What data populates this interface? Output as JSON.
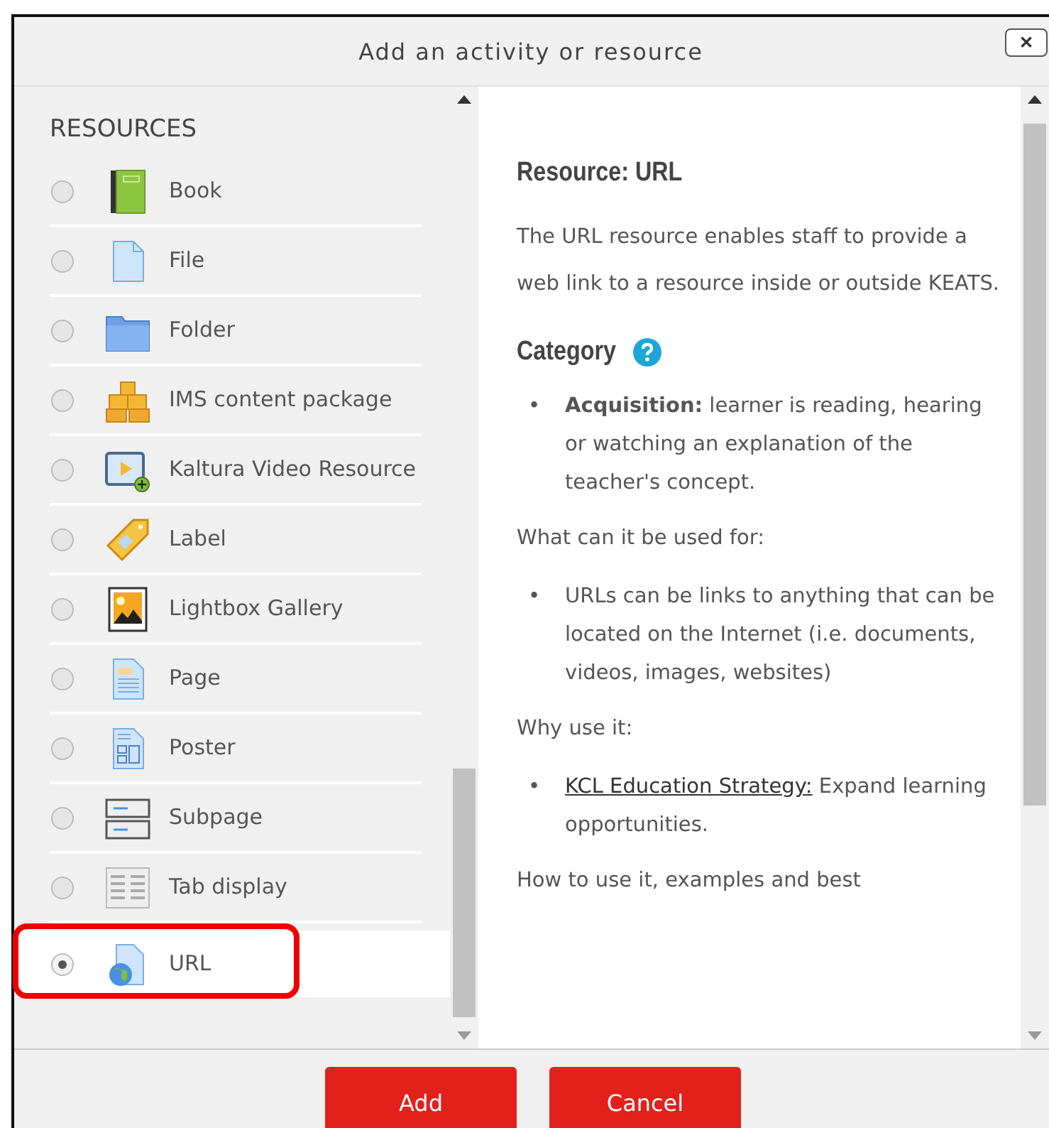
{
  "dialog": {
    "title": "Add an activity or resource",
    "close": "✕"
  },
  "section_title": "RESOURCES",
  "items": [
    {
      "label": "Book",
      "kind": "book",
      "selected": false
    },
    {
      "label": "File",
      "kind": "file",
      "selected": false
    },
    {
      "label": "Folder",
      "kind": "folder",
      "selected": false
    },
    {
      "label": "IMS content package",
      "kind": "package",
      "selected": false
    },
    {
      "label": "Kaltura Video Resource",
      "kind": "video",
      "selected": false
    },
    {
      "label": "Label",
      "kind": "label",
      "selected": false
    },
    {
      "label": "Lightbox Gallery",
      "kind": "gallery",
      "selected": false
    },
    {
      "label": "Page",
      "kind": "page",
      "selected": false
    },
    {
      "label": "Poster",
      "kind": "poster",
      "selected": false
    },
    {
      "label": "Subpage",
      "kind": "subpage",
      "selected": false
    },
    {
      "label": "Tab display",
      "kind": "tabs",
      "selected": false
    },
    {
      "label": "URL",
      "kind": "url",
      "selected": true,
      "highlighted": true
    }
  ],
  "details": [
    {
      "kind": "heading",
      "text": "Resource: URL"
    },
    {
      "kind": "paragraph",
      "text": "The URL resource enables staff to provide a web link to a resource inside or outside KEATS."
    },
    {
      "kind": "heading",
      "text": "Category",
      "help": true
    },
    {
      "kind": "bullets",
      "items": [
        {
          "marker": "•",
          "text": "**Acquisition:** learner is reading, hearing or watching an explanation of the teacher's concept."
        }
      ]
    },
    {
      "kind": "label",
      "text": "What can it be used for:"
    },
    {
      "kind": "bullets",
      "items": [
        {
          "marker": "•",
          "text": "URLs can be links to anything that can be located on the Internet (i.e. documents, videos, images, websites)"
        }
      ]
    },
    {
      "kind": "label",
      "text": "Why use it:"
    },
    {
      "kind": "bullets",
      "items": [
        {
          "marker": "•",
          "link": "KCL Education Strategy:",
          "text": " Expand learning opportunities."
        }
      ]
    },
    {
      "kind": "label",
      "text": "How to use it, examples and best"
    }
  ],
  "buttons": [
    "Add",
    "Cancel"
  ]
}
